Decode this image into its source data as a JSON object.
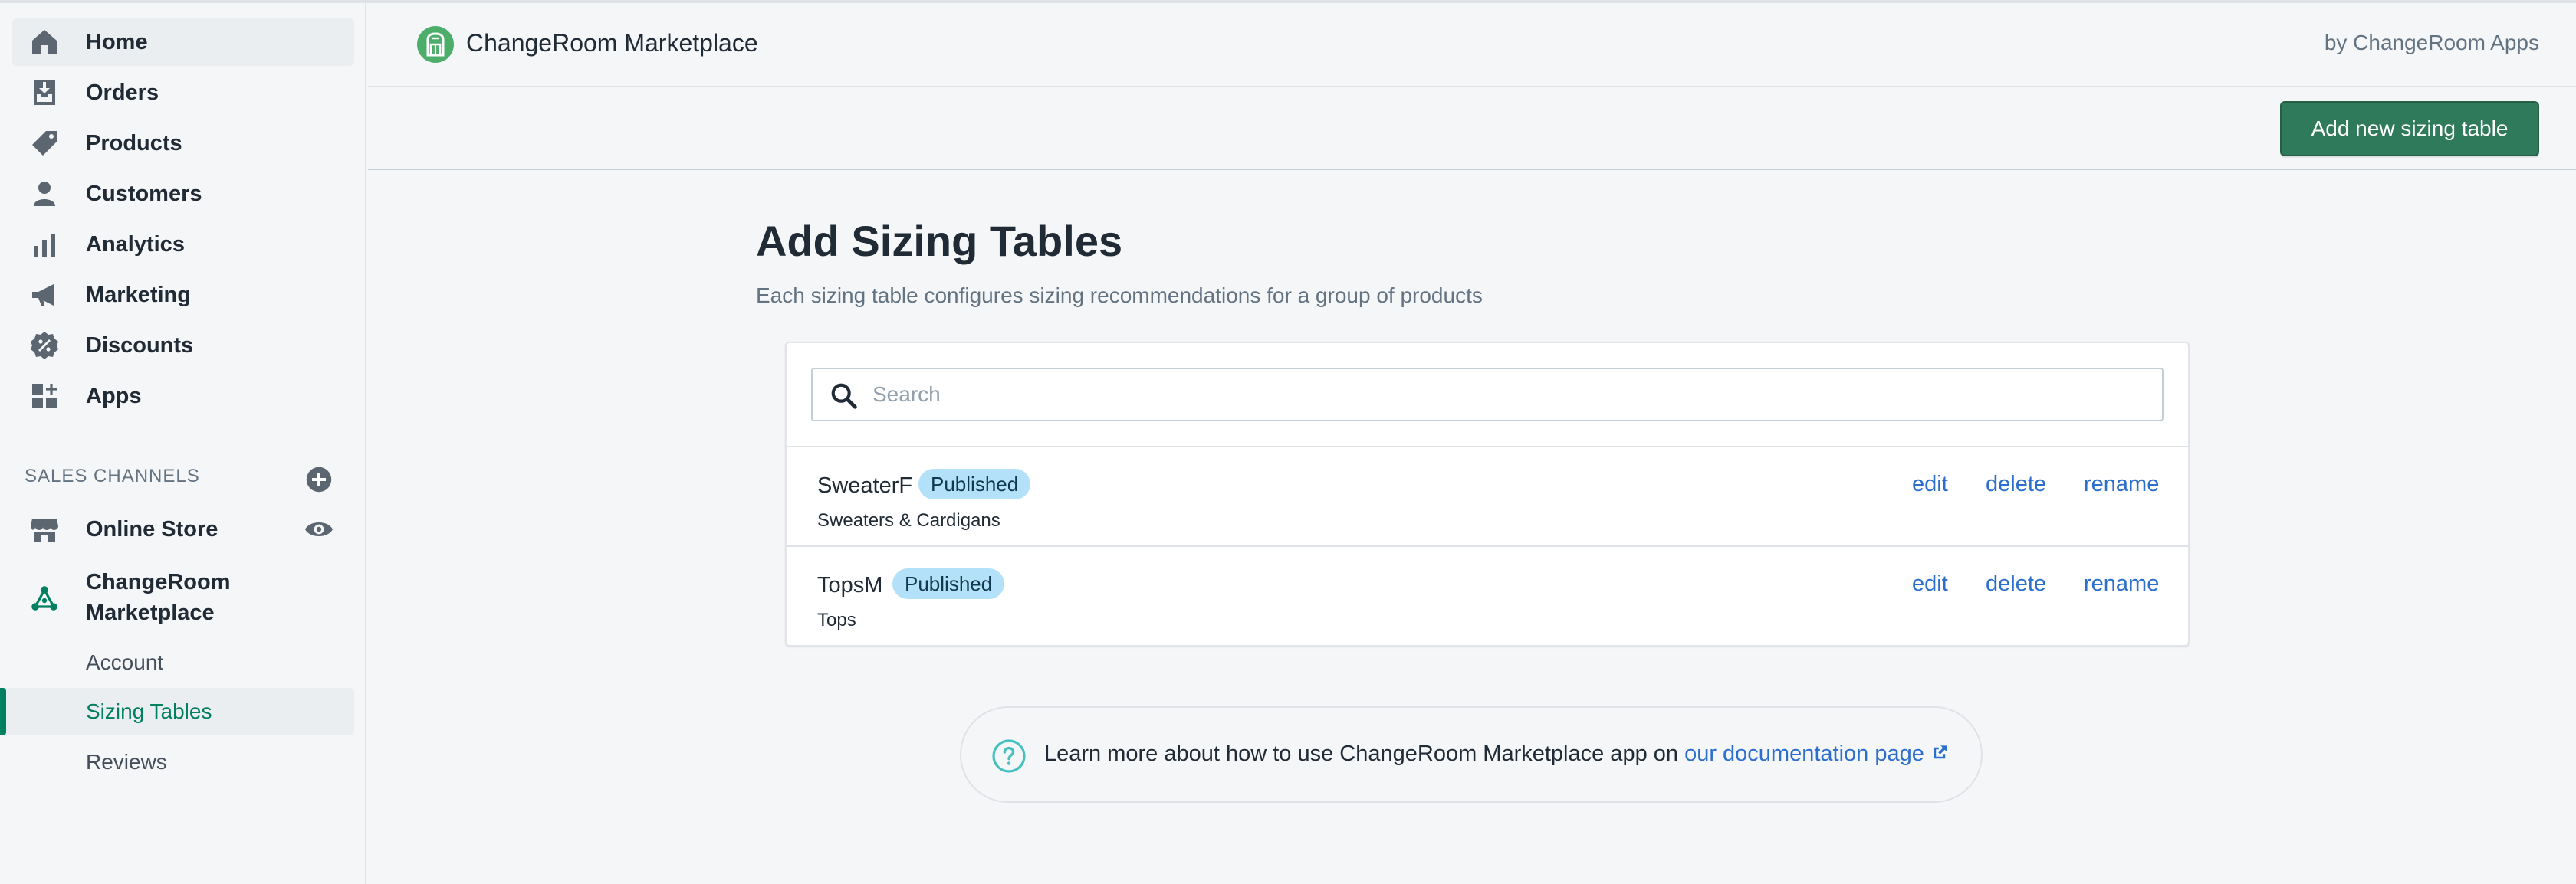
{
  "sidebar": {
    "items": [
      {
        "label": "Home",
        "icon": "home-icon"
      },
      {
        "label": "Orders",
        "icon": "orders-icon"
      },
      {
        "label": "Products",
        "icon": "tag-icon"
      },
      {
        "label": "Customers",
        "icon": "person-icon"
      },
      {
        "label": "Analytics",
        "icon": "bar-chart-icon"
      },
      {
        "label": "Marketing",
        "icon": "megaphone-icon"
      },
      {
        "label": "Discounts",
        "icon": "discount-icon"
      },
      {
        "label": "Apps",
        "icon": "apps-icon"
      }
    ],
    "sales_channels_label": "SALES CHANNELS",
    "online_store_label": "Online Store",
    "changeroom_label": "ChangeRoom Marketplace",
    "sub_items": [
      {
        "label": "Account"
      },
      {
        "label": "Sizing Tables"
      },
      {
        "label": "Reviews"
      }
    ]
  },
  "header": {
    "app_title": "ChangeRoom Marketplace",
    "by_label": "by ChangeRoom Apps"
  },
  "actions": {
    "add_button": "Add new sizing table"
  },
  "main": {
    "title": "Add Sizing Tables",
    "subtitle": "Each sizing table configures sizing recommendations for a group of products",
    "search_placeholder": "Search",
    "rows": [
      {
        "name": "SweaterF",
        "status": "Published",
        "category": "Sweaters & Cardigans",
        "edit": "edit",
        "delete": "delete",
        "rename": "rename"
      },
      {
        "name": "TopsM",
        "status": "Published",
        "category": "Tops",
        "edit": "edit",
        "delete": "delete",
        "rename": "rename"
      }
    ],
    "help_text": "Learn more about how to use ChangeRoom Marketplace app on ",
    "help_link": "our documentation page"
  },
  "colors": {
    "accent_green": "#2f7a5a",
    "link_blue": "#2c6ecb",
    "badge_blue": "#b4e1fa"
  }
}
